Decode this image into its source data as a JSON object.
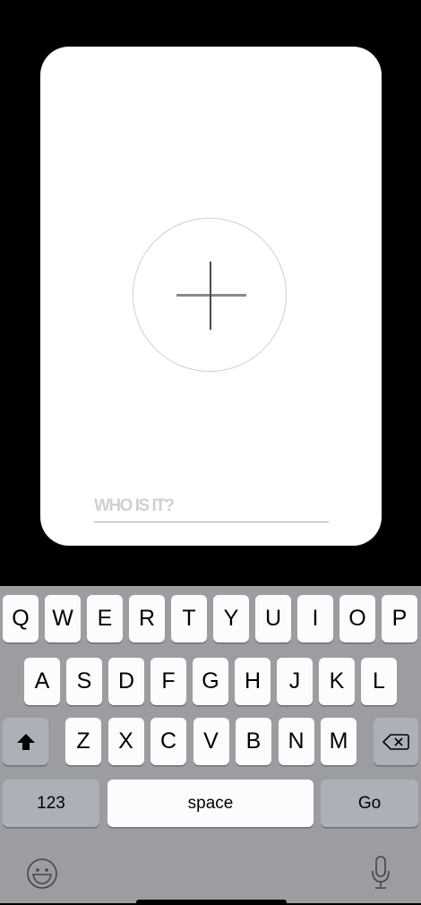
{
  "card": {
    "add_button_icon": "plus-icon",
    "name_input": {
      "placeholder": "WHO IS IT?",
      "value": ""
    }
  },
  "keyboard": {
    "row1": [
      "Q",
      "W",
      "E",
      "R",
      "T",
      "Y",
      "U",
      "I",
      "O",
      "P"
    ],
    "row2": [
      "A",
      "S",
      "D",
      "F",
      "G",
      "H",
      "J",
      "K",
      "L"
    ],
    "row3": [
      "Z",
      "X",
      "C",
      "V",
      "B",
      "N",
      "M"
    ],
    "shift_icon": "shift-arrow-icon",
    "backspace_icon": "backspace-icon",
    "numbers_label": "123",
    "space_label": "space",
    "return_label": "Go",
    "emoji_icon": "emoji-icon",
    "mic_icon": "microphone-icon"
  }
}
